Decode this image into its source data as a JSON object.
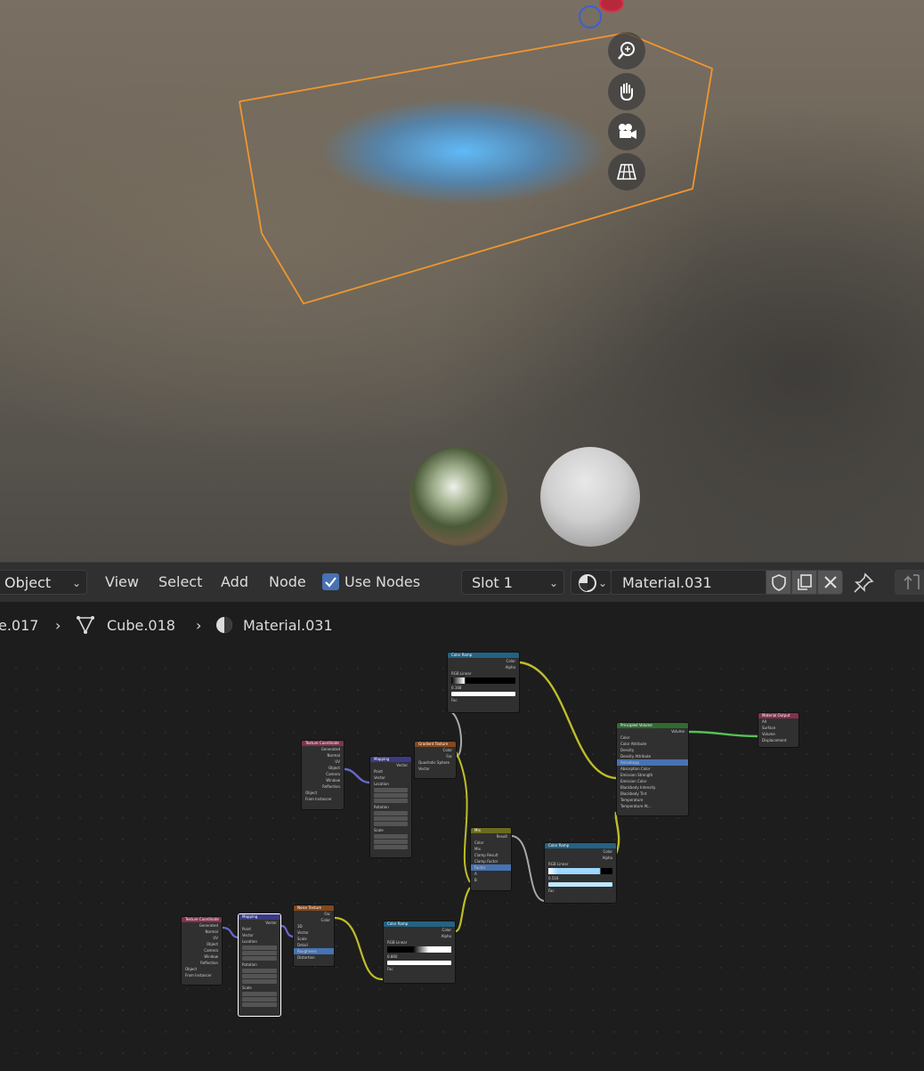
{
  "header": {
    "mode": "Object",
    "menus": [
      "View",
      "Select",
      "Add",
      "Node"
    ],
    "use_nodes_label": "Use Nodes",
    "use_nodes_checked": true,
    "slot": "Slot 1",
    "material_name": "Material.031"
  },
  "breadcrumb": {
    "items": [
      "e.017",
      "Cube.018",
      "Material.031"
    ]
  },
  "nodes": {
    "color_ramp_top": {
      "title": "Color Ramp",
      "outs": [
        "Color",
        "Alpha"
      ],
      "mode": "RGB",
      "interp": "Linear",
      "pos": "0.168",
      "in": "Fac"
    },
    "tex_coord_1": {
      "title": "Texture Coordinate",
      "outs": [
        "Generated",
        "Normal",
        "UV",
        "Object",
        "Camera",
        "Window",
        "Reflection"
      ],
      "obj": "Object",
      "inst": "From Instancer"
    },
    "mapping_1": {
      "title": "Mapping",
      "out": "Vector",
      "type": "Point",
      "in": "Vector",
      "loc": "Location",
      "rot": "Rotation",
      "scale": "Scale"
    },
    "gradient": {
      "title": "Gradient Texture",
      "outs": [
        "Color",
        "Fac"
      ],
      "type": "Quadratic Sphere",
      "in": "Vector"
    },
    "principled_volume": {
      "title": "Principled Volume",
      "out": "Volume",
      "rows": [
        "Color",
        "Color Attribute",
        "Density",
        "Density Attribute",
        "Anisotropy",
        "Absorption Color",
        "Emission Strength",
        "Emission Color",
        "Blackbody Intensity",
        "Blackbody Tint",
        "Temperature",
        "Temperature At..."
      ]
    },
    "material_output": {
      "title": "Material Output",
      "target": "All",
      "ins": [
        "Surface",
        "Volume",
        "Displacement"
      ]
    },
    "mix": {
      "title": "Mix",
      "out": "Result",
      "type": "Color",
      "blend": "Mix",
      "clamp_result": "Clamp Result",
      "clamp_factor": "Clamp Factor",
      "factor": "Factor",
      "ins": [
        "A",
        "B"
      ]
    },
    "color_ramp_mid": {
      "title": "Color Ramp",
      "outs": [
        "Color",
        "Alpha"
      ],
      "mode": "RGB",
      "interp": "Linear",
      "pos": "0.516",
      "in": "Fac"
    },
    "tex_coord_2": {
      "title": "Texture Coordinate",
      "outs": [
        "Generated",
        "Normal",
        "UV",
        "Object",
        "Camera",
        "Window",
        "Reflection"
      ],
      "obj": "Object",
      "inst": "From Instancer"
    },
    "mapping_2": {
      "title": "Mapping",
      "out": "Vector",
      "type": "Point",
      "in": "Vector",
      "loc": "Location",
      "rot": "Rotation",
      "scale": "Scale"
    },
    "noise": {
      "title": "Noise Texture",
      "outs": [
        "Fac",
        "Color"
      ],
      "dim": "3D",
      "in": "Vector",
      "rows": [
        "Scale",
        "Detail",
        "Roughness",
        "Distortion"
      ]
    },
    "color_ramp_bottom": {
      "title": "Color Ramp",
      "outs": [
        "Color",
        "Alpha"
      ],
      "mode": "RGB",
      "interp": "Linear",
      "pos": "0.860",
      "in": "Fac"
    }
  },
  "colors": {
    "selection_outline": "#f0962e",
    "header_bg": "#303030",
    "editor_bg": "#1d1d1d",
    "checkbox_blue": "#4772b3",
    "link_yellow": "#c7c729",
    "link_green": "#63c763",
    "link_purple": "#6363c7",
    "link_gray": "#a1a1a1"
  },
  "icons": [
    "zoom-icon",
    "hand-pan-icon",
    "camera-icon",
    "grid-icon",
    "node-tree-icon",
    "material-sphere-icon",
    "shield-icon",
    "duplicate-icon",
    "close-icon",
    "pin-icon",
    "parent-arrow-icon"
  ]
}
